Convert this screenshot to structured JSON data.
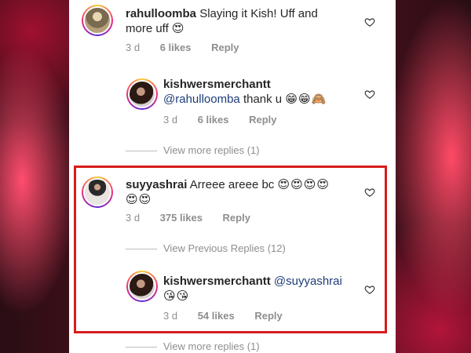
{
  "comments": [
    {
      "username": "rahulloomba",
      "text": "Slaying it Kish! Uff and more uff",
      "emoji": "😍",
      "time": "3 d",
      "likes": "6 likes",
      "reply": "Reply"
    },
    {
      "username": "kishwersmerchantt",
      "mention": "@rahulloomba",
      "text": " thank u",
      "emoji": "😁😁🙈",
      "time": "3 d",
      "likes": "6 likes",
      "reply": "Reply"
    },
    {
      "username": "suyyashrai",
      "text": "Arreee areee bc",
      "emoji": "😍😍😍😍",
      "emoji2": "😍😍",
      "time": "3 d",
      "likes": "375 likes",
      "reply": "Reply"
    },
    {
      "username": "kishwersmerchantt",
      "mention": "@suyyashrai",
      "emoji": "😘😘",
      "time": "3 d",
      "likes": "54 likes",
      "reply": "Reply"
    }
  ],
  "view_more_1": "View more replies (1)",
  "view_previous": "View Previous Replies (12)",
  "view_more_2": "View more replies (1)",
  "colors": {
    "highlight": "#d71c1c",
    "mention": "#1d3c78",
    "meta": "#8e8e8e"
  }
}
